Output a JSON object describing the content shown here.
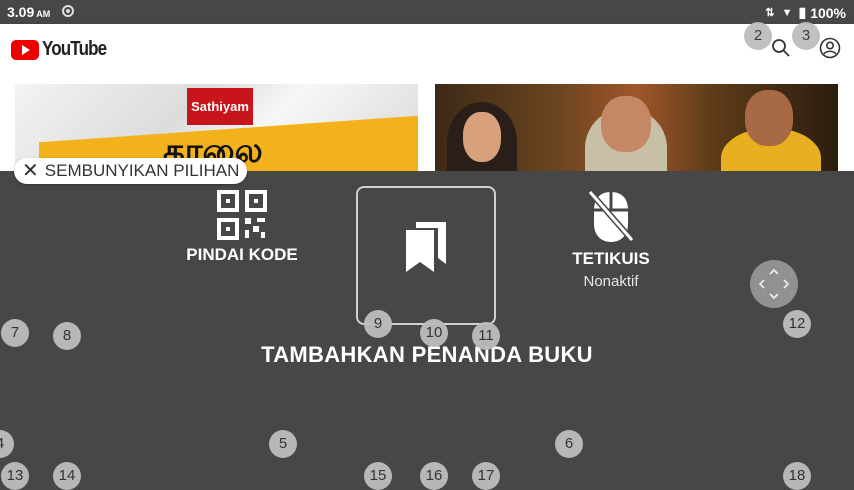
{
  "status_bar": {
    "time": "3.09",
    "ampm": "AM",
    "battery": "100%"
  },
  "header": {
    "app_name": "YouTube"
  },
  "thumbnails": [
    {
      "channel": "Sathiyam",
      "title_text": "காலை"
    },
    {
      "channel": ""
    }
  ],
  "overlay": {
    "hide_label": "SEMBUNYIKAN PILIHAN",
    "scan_label": "PINDAI KODE",
    "mouse_label": "TETIKUIS",
    "mouse_status": "Nonaktif",
    "bookmark_caption": "TAMBAHKAN PENANDA BUKU"
  },
  "markers": [
    "2",
    "3",
    "7",
    "8",
    "9",
    "10",
    "11",
    "12",
    "4",
    "5",
    "6",
    "13",
    "14",
    "15",
    "16",
    "17",
    "18"
  ],
  "colors": {
    "overlay_bg": "#474747",
    "youtube_red": "#e00000",
    "chip_bg": "#ffffff"
  }
}
